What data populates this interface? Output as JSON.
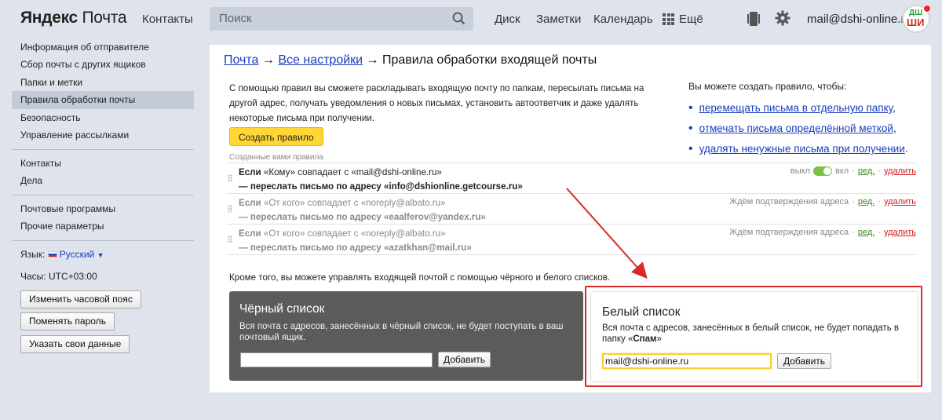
{
  "header": {
    "logo_brand": "Яндекс",
    "logo_product": "Почта",
    "contacts_link": "Контакты",
    "search_placeholder": "Поиск",
    "disk_link": "Диск",
    "notes_link": "Заметки",
    "calendar_link": "Календарь",
    "more_label": "Ещё",
    "user_email": "mail@dshi-online.ru",
    "avatar_top": "ДШ",
    "avatar_bottom": "ШИ"
  },
  "sidebar": {
    "group1": [
      {
        "label": "Информация об отправителе",
        "active": false
      },
      {
        "label": "Сбор почты с других ящиков",
        "active": false
      },
      {
        "label": "Папки и метки",
        "active": false
      },
      {
        "label": "Правила обработки почты",
        "active": true
      },
      {
        "label": "Безопасность",
        "active": false
      },
      {
        "label": "Управление рассылками",
        "active": false
      }
    ],
    "group2": [
      {
        "label": "Контакты"
      },
      {
        "label": "Дела"
      }
    ],
    "group3": [
      {
        "label": "Почтовые программы"
      },
      {
        "label": "Прочие параметры"
      }
    ],
    "language_label": "Язык:",
    "language_value": "Русский",
    "clock_label": "Часы:",
    "clock_value": "UTC+03:00",
    "btn_timezone": "Изменить часовой пояс",
    "btn_password": "Поменять пароль",
    "btn_data": "Указать свои данные"
  },
  "main": {
    "breadcrumb": {
      "mail": "Почта",
      "arrow": "→",
      "all_settings": "Все настройки",
      "current": "Правила обработки входящей почты"
    },
    "intro_text": "С помощью правил вы сможете раскладывать входящую почту по папкам, пересылать письма на другой адрес, получать уведомления о новых письмах, установить автоответчик и даже удалять некоторые письма при получении.",
    "create_rule_button": "Создать правило",
    "can_create_title": "Вы можете создать правило, чтобы:",
    "can_create_items": [
      {
        "link": "перемещать письма в отдельную папку",
        "tail": ","
      },
      {
        "link": "отмечать письма определённой меткой",
        "tail": ","
      },
      {
        "link": "удалять ненужные письма при получении",
        "tail": "."
      }
    ],
    "rules_title": "Созданные вами правила",
    "rules": [
      {
        "if_word": "Если",
        "condition": " «Кому» совпадает с «mail@dshi-online.ru»",
        "action": "— переслать письмо по адресу «info@dshionline.getcourse.ru»",
        "status_off": "выкл",
        "status_on": "вкл",
        "pending": "",
        "edit": "ред.",
        "delete": "удалить",
        "dim": false
      },
      {
        "if_word": "Если",
        "condition": " «От кого» совпадает с «noreply@albato.ru»",
        "action": "— переслать письмо по адресу «eaalferov@yandex.ru»",
        "status_off": "",
        "status_on": "",
        "pending": "Ждём подтверждения адреса",
        "edit": "ред.",
        "delete": "удалить",
        "dim": true
      },
      {
        "if_word": "Если",
        "condition": " «От кого» совпадает с «noreply@albato.ru»",
        "action": "— переслать письмо по адресу «azatkhan@mail.ru»",
        "status_off": "",
        "status_on": "",
        "pending": "Ждём подтверждения адреса",
        "edit": "ред.",
        "delete": "удалить",
        "dim": true
      }
    ],
    "rule_separator": "·",
    "lists_note": "Кроме того, вы можете управлять входящей почтой с помощью чёрного и белого списков.",
    "blacklist": {
      "title": "Чёрный список",
      "description": "Вся почта с адресов, занесённых в чёрный список, не будет поступать в ваш почтовый ящик.",
      "input_value": "",
      "add_button": "Добавить"
    },
    "whitelist": {
      "title": "Белый список",
      "description_prefix": "Вся почта с адресов, занесённых в белый список, не будет попадать в папку «",
      "description_bold": "Спам",
      "description_suffix": "»",
      "input_value": "mail@dshi-online.ru",
      "add_button": "Добавить"
    }
  },
  "colors": {
    "accent_yellow": "#ffd633",
    "annotation_red": "#d82a2a",
    "link_blue": "#1a3dbf",
    "toggle_green": "#7ac142"
  }
}
